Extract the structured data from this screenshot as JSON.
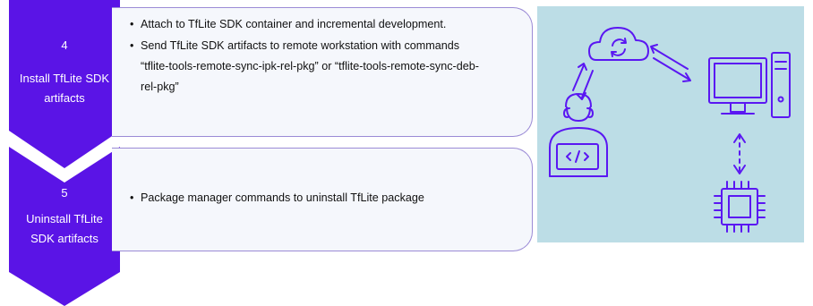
{
  "steps": [
    {
      "number": "4",
      "label_line1": "Install TfLite SDK",
      "label_line2": "artifacts",
      "bullets": [
        "Attach to TfLite SDK container and incremental development.",
        "Send TfLite SDK artifacts to remote workstation with commands"
      ],
      "bullet_cont": [
        "“tflite-tools-remote-sync-ipk-rel-pkg” or “tflite-tools-remote-sync-deb-",
        "rel-pkg”"
      ]
    },
    {
      "number": "5",
      "label_line1": "Uninstall TfLite",
      "label_line2": "SDK artifacts",
      "bullets": [
        "Package manager commands to uninstall TfLite package"
      ]
    }
  ],
  "illustration": {
    "background": "#bcdde6",
    "stroke_color": "#5a17f2",
    "icons": [
      "cloud-sync-icon",
      "developer-laptop-icon",
      "workstation-icon",
      "chip-icon",
      "bidirectional-arrow-icon"
    ]
  },
  "colors": {
    "accent": "#5a14e6",
    "box_border": "#9b8bd6",
    "box_fill": "#f5f7fc"
  }
}
